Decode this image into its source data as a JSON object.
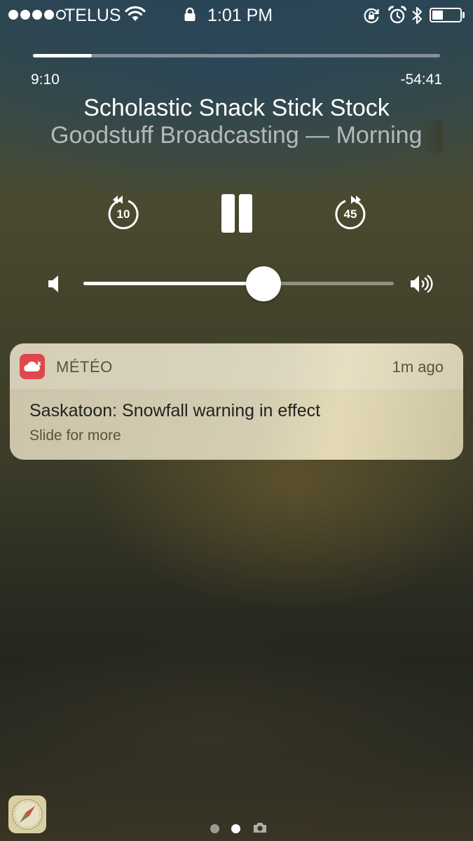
{
  "status_bar": {
    "signal_dots_filled": 4,
    "signal_dots_total": 5,
    "carrier": "TELUS",
    "time": "1:01 PM",
    "battery_level": 0.4,
    "icons": [
      "wifi-icon",
      "lock-icon",
      "rotation-lock-icon",
      "alarm-icon",
      "bluetooth-icon",
      "battery-icon"
    ]
  },
  "now_playing": {
    "elapsed": "9:10",
    "remaining": "-54:41",
    "progress": 0.144,
    "title": "Scholastic Snack Stick Stock",
    "artist": "Goodstuff Broadcasting — Morning",
    "skip_back_seconds": "10",
    "skip_forward_seconds": "45",
    "volume": 0.58,
    "icons": [
      "skip-back-icon",
      "pause-icon",
      "skip-forward-icon",
      "volume-low-icon",
      "volume-high-icon"
    ]
  },
  "notification": {
    "app_name": "MÉTÉO",
    "time_ago": "1m ago",
    "title": "Saskatoon: Snowfall warning in effect",
    "subtitle": "Slide for more",
    "icon": "weather-app-icon",
    "accent_color": "#e0474c"
  },
  "bottom": {
    "page_count": 2,
    "current_page": 2,
    "icons": [
      "safari-app-icon",
      "camera-icon"
    ]
  }
}
